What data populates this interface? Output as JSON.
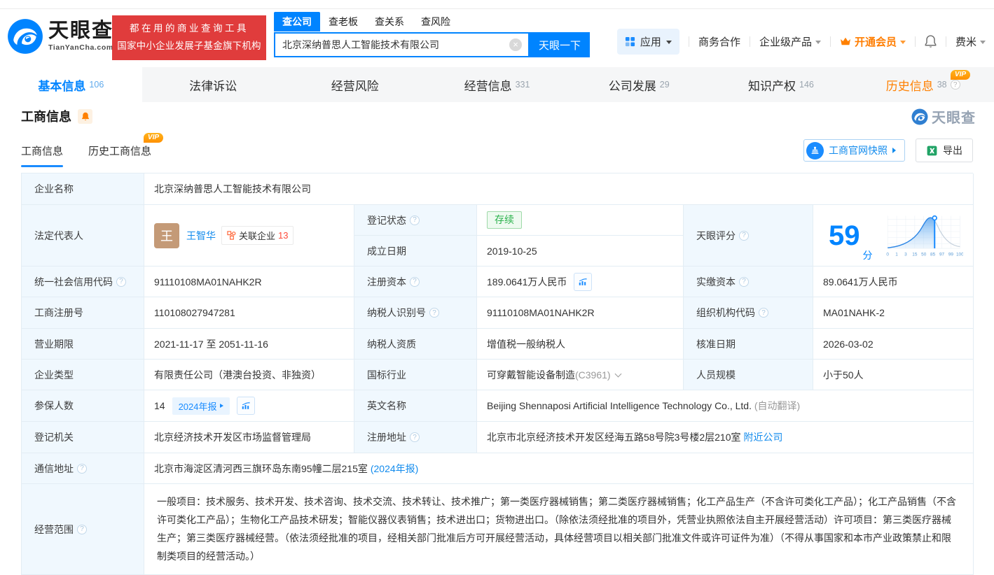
{
  "brand": {
    "name": "天眼查",
    "domain": "TianYanCha.com",
    "slogan1": "都在用的商业查询工具",
    "slogan2": "国家中小企业发展子基金旗下机构"
  },
  "search": {
    "tabs": [
      "查公司",
      "查老板",
      "查关系",
      "查风险"
    ],
    "value": "北京深纳普思人工智能技术有限公司",
    "button": "天眼一下"
  },
  "topnav": {
    "apps": "应用",
    "cooperation": "商务合作",
    "enterprise": "企业级产品",
    "membership": "开通会员",
    "username": "费米"
  },
  "tabs": [
    {
      "label": "基本信息",
      "count": "106"
    },
    {
      "label": "法律诉讼",
      "count": ""
    },
    {
      "label": "经营风险",
      "count": ""
    },
    {
      "label": "经营信息",
      "count": "331"
    },
    {
      "label": "公司发展",
      "count": "29"
    },
    {
      "label": "知识产权",
      "count": "146"
    },
    {
      "label": "历史信息",
      "count": "38"
    }
  ],
  "section": {
    "title": "工商信息"
  },
  "subtabs": {
    "current": "工商信息",
    "history": "历史工商信息"
  },
  "actions": {
    "snapshot": "工商官网快照",
    "export": "导出"
  },
  "watermark": "天眼查",
  "icons": {
    "help": "?",
    "clear": "×",
    "vip": "VIP"
  },
  "score": {
    "label": "天眼评分",
    "value": "59",
    "unit": "分",
    "axis": [
      "0",
      "1",
      "3",
      "15",
      "50",
      "85",
      "97",
      "99",
      "100"
    ]
  },
  "fields": {
    "company_name": {
      "label": "企业名称",
      "value": "北京深纳普思人工智能技术有限公司"
    },
    "legal_rep": {
      "label": "法定代表人",
      "avatar": "王",
      "name": "王智华",
      "related": "关联企业",
      "related_count": "13"
    },
    "reg_status": {
      "label": "登记状态",
      "value": "存续"
    },
    "establish_date": {
      "label": "成立日期",
      "value": "2019-10-25"
    },
    "credit_code": {
      "label": "统一社会信用代码",
      "value": "91110108MA01NAHK2R"
    },
    "reg_capital": {
      "label": "注册资本",
      "value": "189.0641万人民币"
    },
    "paid_capital": {
      "label": "实缴资本",
      "value": "89.0641万人民币"
    },
    "reg_number": {
      "label": "工商注册号",
      "value": "110108027947281"
    },
    "taxpayer_id": {
      "label": "纳税人识别号",
      "value": "91110108MA01NAHK2R"
    },
    "org_code": {
      "label": "组织机构代码",
      "value": "MA01NAHK-2"
    },
    "business_term": {
      "label": "营业期限",
      "value": "2021-11-17 至 2051-11-16"
    },
    "taxpayer_quality": {
      "label": "纳税人资质",
      "value": "增值税一般纳税人"
    },
    "approval_date": {
      "label": "核准日期",
      "value": "2026-03-02"
    },
    "company_type": {
      "label": "企业类型",
      "value": "有限责任公司（港澳台投资、非独资）"
    },
    "industry": {
      "label": "国标行业",
      "value": "可穿戴智能设备制造",
      "code": "(C3961)"
    },
    "staff_size": {
      "label": "人员规模",
      "value": "小于50人"
    },
    "insured_count": {
      "label": "参保人数",
      "value": "14",
      "badge": "2024年报"
    },
    "english_name": {
      "label": "英文名称",
      "value": "Beijing Shennaposi Artificial Intelligence Technology Co., Ltd.",
      "note": "(自动翻译)"
    },
    "reg_authority": {
      "label": "登记机关",
      "value": "北京经济技术开发区市场监督管理局"
    },
    "reg_address": {
      "label": "注册地址",
      "value": "北京市北京经济技术开发区经海五路58号院3号楼2层210室",
      "link": "附近公司"
    },
    "mail_address": {
      "label": "通信地址",
      "value": "北京市海淀区清河西三旗环岛东南95幢二层215室",
      "link": "(2024年报)"
    },
    "business_scope": {
      "label": "经营范围",
      "value": "一般项目：技术服务、技术开发、技术咨询、技术交流、技术转让、技术推广；第一类医疗器械销售；第二类医疗器械销售；化工产品生产（不含许可类化工产品）；化工产品销售（不含许可类化工产品）；生物化工产品技术研发；智能仪器仪表销售；技术进出口；货物进出口。（除依法须经批准的项目外，凭营业执照依法自主开展经营活动）许可项目：第三类医疗器械生产；第三类医疗器械经营。（依法须经批准的项目，经相关部门批准后方可开展经营活动，具体经营项目以相关部门批准文件或许可证件为准）（不得从事国家和本市产业政策禁止和限制类项目的经营活动。）"
    }
  }
}
